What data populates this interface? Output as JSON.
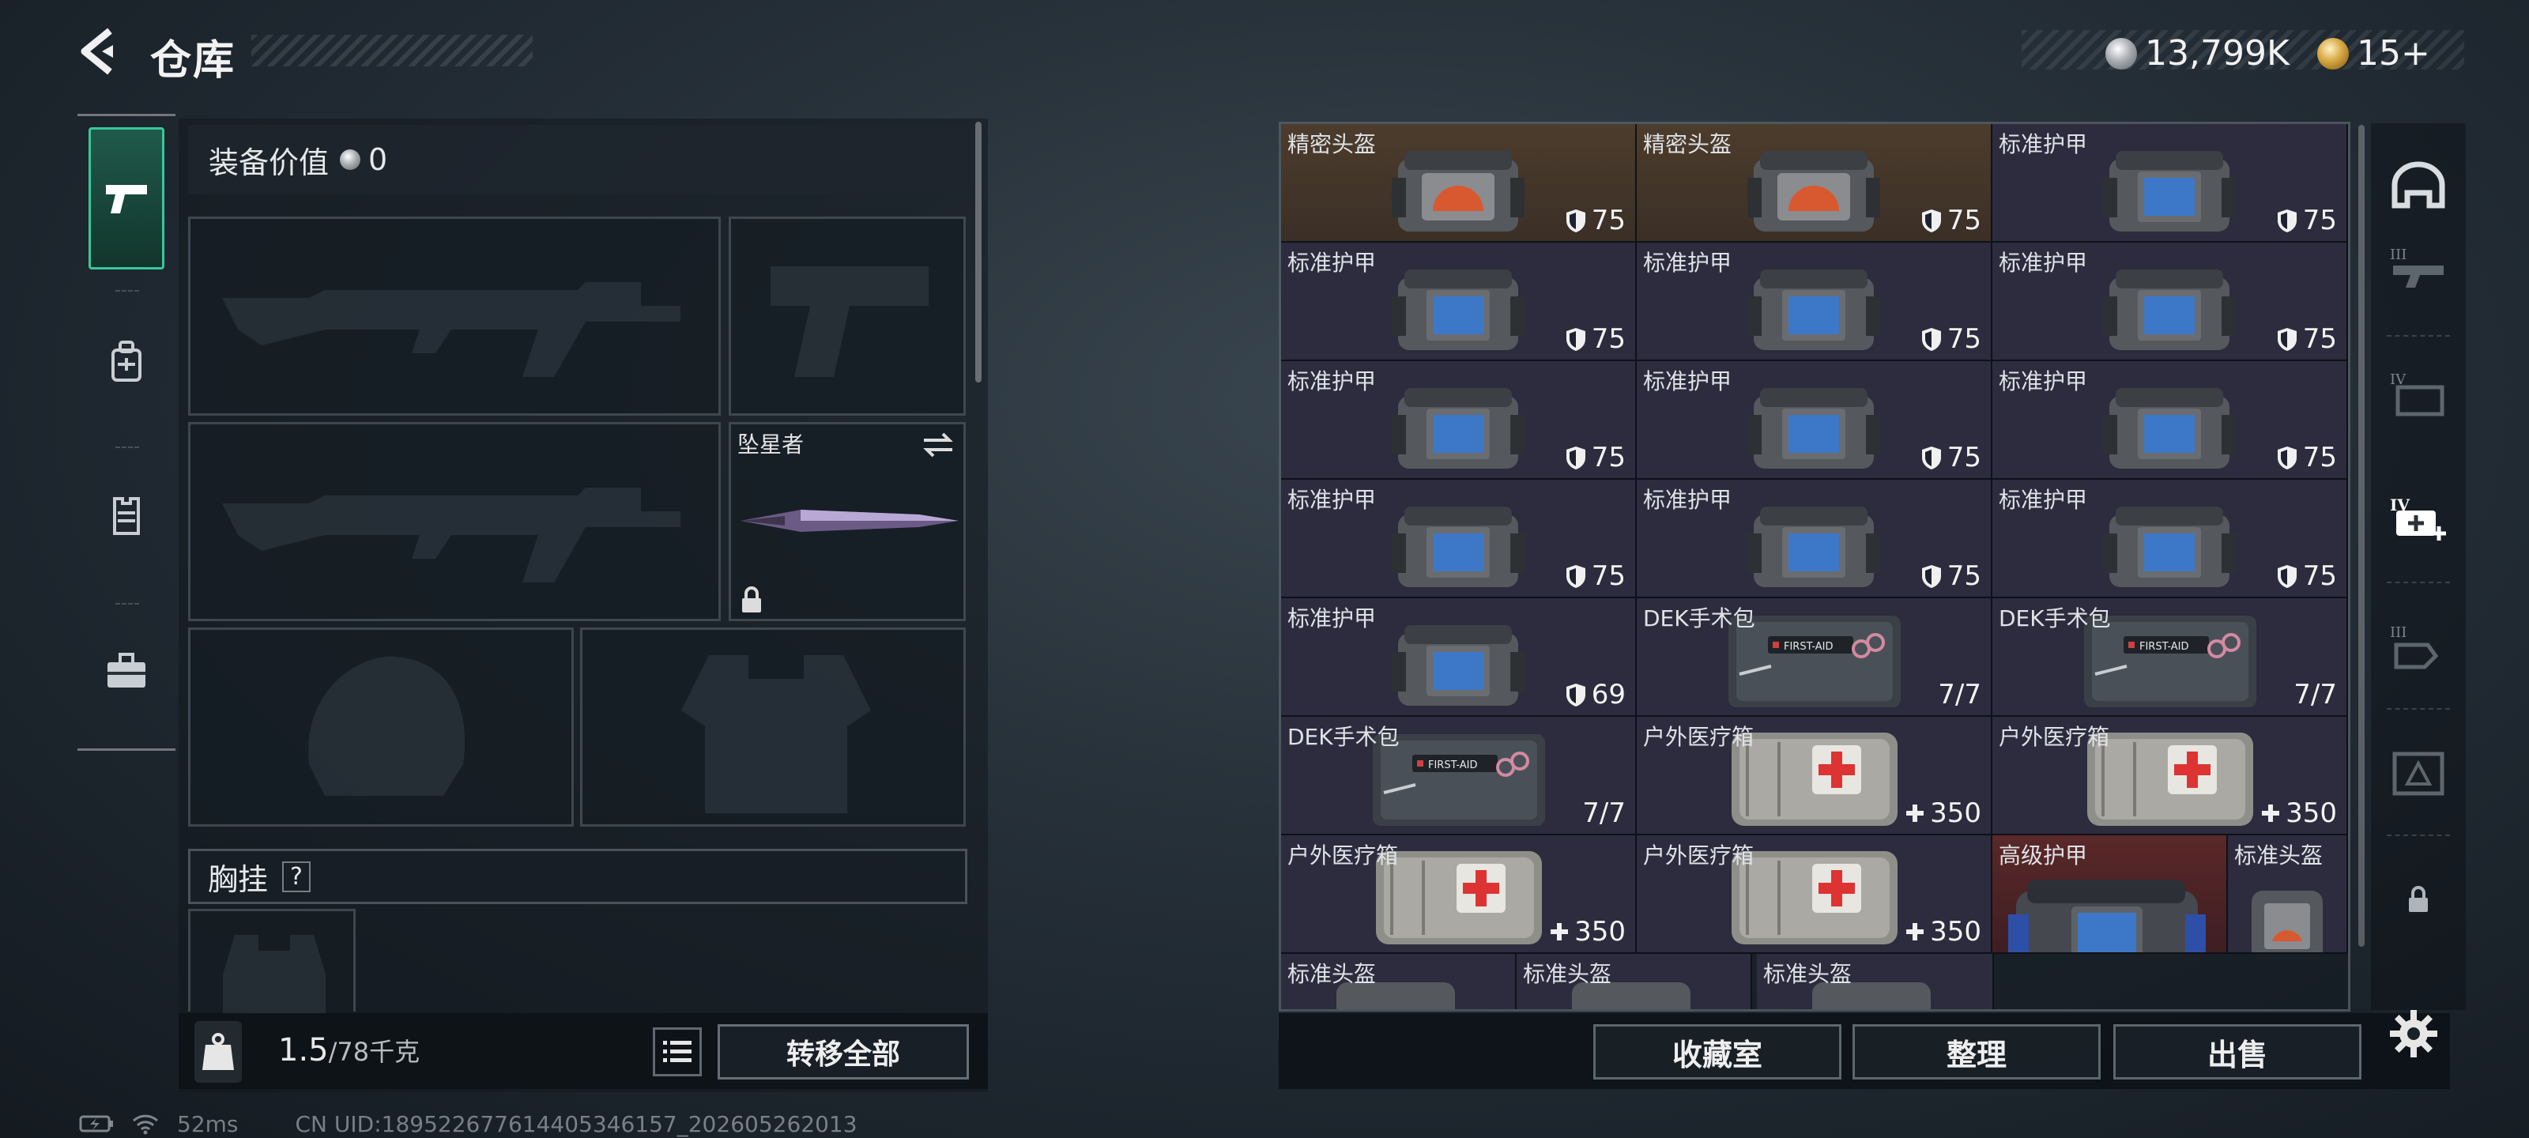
{
  "header": {
    "title": "仓库",
    "silver_amount": "13,799K",
    "gold_amount": "15+"
  },
  "left_nav": [
    "weapons-tab",
    "backpack-tab",
    "armor-tab",
    "toolbox-tab"
  ],
  "equipment": {
    "value_label": "装备价值",
    "value": "0",
    "melee_name": "坠星者",
    "chest_label": "胸挂",
    "chest_help": "?",
    "weight_current": "1.5",
    "weight_max": "/78千克",
    "kg_icon_text": "KG",
    "transfer_all": "转移全部"
  },
  "stash": {
    "rows": [
      [
        {
          "name": "精密头盔",
          "value": "75",
          "kind": "helmet",
          "bg": "gold"
        },
        {
          "name": "精密头盔",
          "value": "75",
          "kind": "helmet",
          "bg": "gold"
        },
        {
          "name": "标准护甲",
          "value": "75",
          "kind": "armor",
          "bg": "purple"
        }
      ],
      [
        {
          "name": "标准护甲",
          "value": "75",
          "kind": "armor",
          "bg": "purple"
        },
        {
          "name": "标准护甲",
          "value": "75",
          "kind": "armor",
          "bg": "purple"
        },
        {
          "name": "标准护甲",
          "value": "75",
          "kind": "armor",
          "bg": "purple"
        }
      ],
      [
        {
          "name": "标准护甲",
          "value": "75",
          "kind": "armor",
          "bg": "purple"
        },
        {
          "name": "标准护甲",
          "value": "75",
          "kind": "armor",
          "bg": "purple"
        },
        {
          "name": "标准护甲",
          "value": "75",
          "kind": "armor",
          "bg": "purple"
        }
      ],
      [
        {
          "name": "标准护甲",
          "value": "75",
          "kind": "armor",
          "bg": "purple"
        },
        {
          "name": "标准护甲",
          "value": "75",
          "kind": "armor",
          "bg": "purple"
        },
        {
          "name": "标准护甲",
          "value": "75",
          "kind": "armor",
          "bg": "purple"
        }
      ],
      [
        {
          "name": "标准护甲",
          "value": "69",
          "kind": "armor",
          "bg": "purple"
        },
        {
          "name": "DEK手术包",
          "value": "7/7",
          "kind": "surgery",
          "bg": "purple"
        },
        {
          "name": "DEK手术包",
          "value": "7/7",
          "kind": "surgery",
          "bg": "purple"
        }
      ],
      [
        {
          "name": "DEK手术包",
          "value": "7/7",
          "kind": "surgery",
          "bg": "purple"
        },
        {
          "name": "户外医疗箱",
          "value": "350",
          "kind": "medkit",
          "bg": "purple"
        },
        {
          "name": "户外医疗箱",
          "value": "350",
          "kind": "medkit",
          "bg": "purple"
        }
      ],
      [
        {
          "name": "户外医疗箱",
          "value": "350",
          "kind": "medkit",
          "bg": "purple"
        },
        {
          "name": "户外医疗箱",
          "value": "350",
          "kind": "medkit",
          "bg": "purple"
        },
        {
          "name": "高级护甲",
          "value": "",
          "kind": "armor",
          "bg": "red"
        }
      ]
    ],
    "helmet_right_name": "标准头盔",
    "partial_row": [
      "标准头盔",
      "标准头盔",
      "标准头盔"
    ]
  },
  "actions": {
    "collection": "收藏室",
    "organize": "整理",
    "sell": "出售"
  },
  "status": {
    "ping": "52ms",
    "uid": "CN UID:18952267761440534615​7_202605262013"
  },
  "colors": {
    "accent_green": "#38c79a",
    "cell_purple": "#2c2c3e",
    "cell_gold": "#4c3c2c",
    "cell_red": "#5a2828"
  }
}
